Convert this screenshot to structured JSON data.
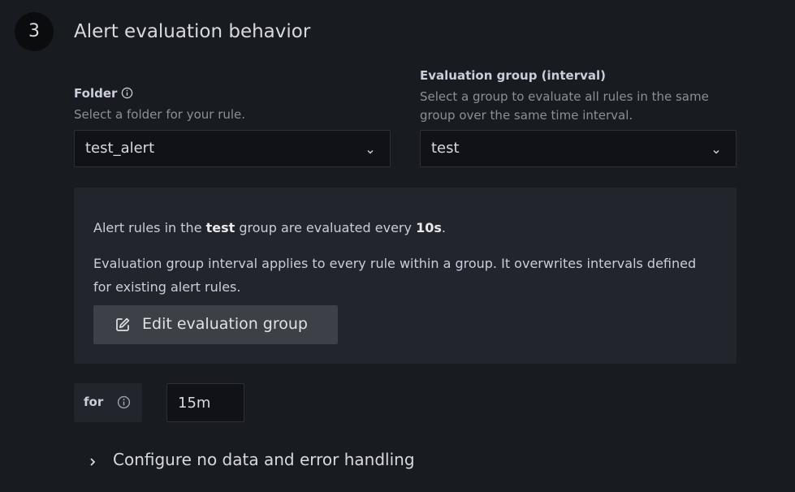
{
  "section": {
    "step_number": "3",
    "title": "Alert evaluation behavior"
  },
  "folder": {
    "label": "Folder",
    "description": "Select a folder for your rule.",
    "value": "test_alert"
  },
  "evaluation_group": {
    "label": "Evaluation group (interval)",
    "description": "Select a group to evaluate all rules in the same group over the same time interval.",
    "value": "test"
  },
  "info_box": {
    "line1_prefix": "Alert rules in the ",
    "group_name": "test",
    "line1_middle": " group are evaluated every ",
    "interval": "10s",
    "line1_suffix": ".",
    "line2": "Evaluation group interval applies to every rule within a group. It overwrites intervals defined for existing alert rules.",
    "edit_button_label": "Edit evaluation group"
  },
  "pending_period": {
    "label": "for",
    "value": "15m"
  },
  "error_handling": {
    "label": "Configure no data and error handling"
  },
  "icons": {
    "info": "info-circle-icon",
    "chevron_down": "chevron-down-icon",
    "chevron_right": "chevron-right-icon",
    "edit": "edit-icon"
  }
}
